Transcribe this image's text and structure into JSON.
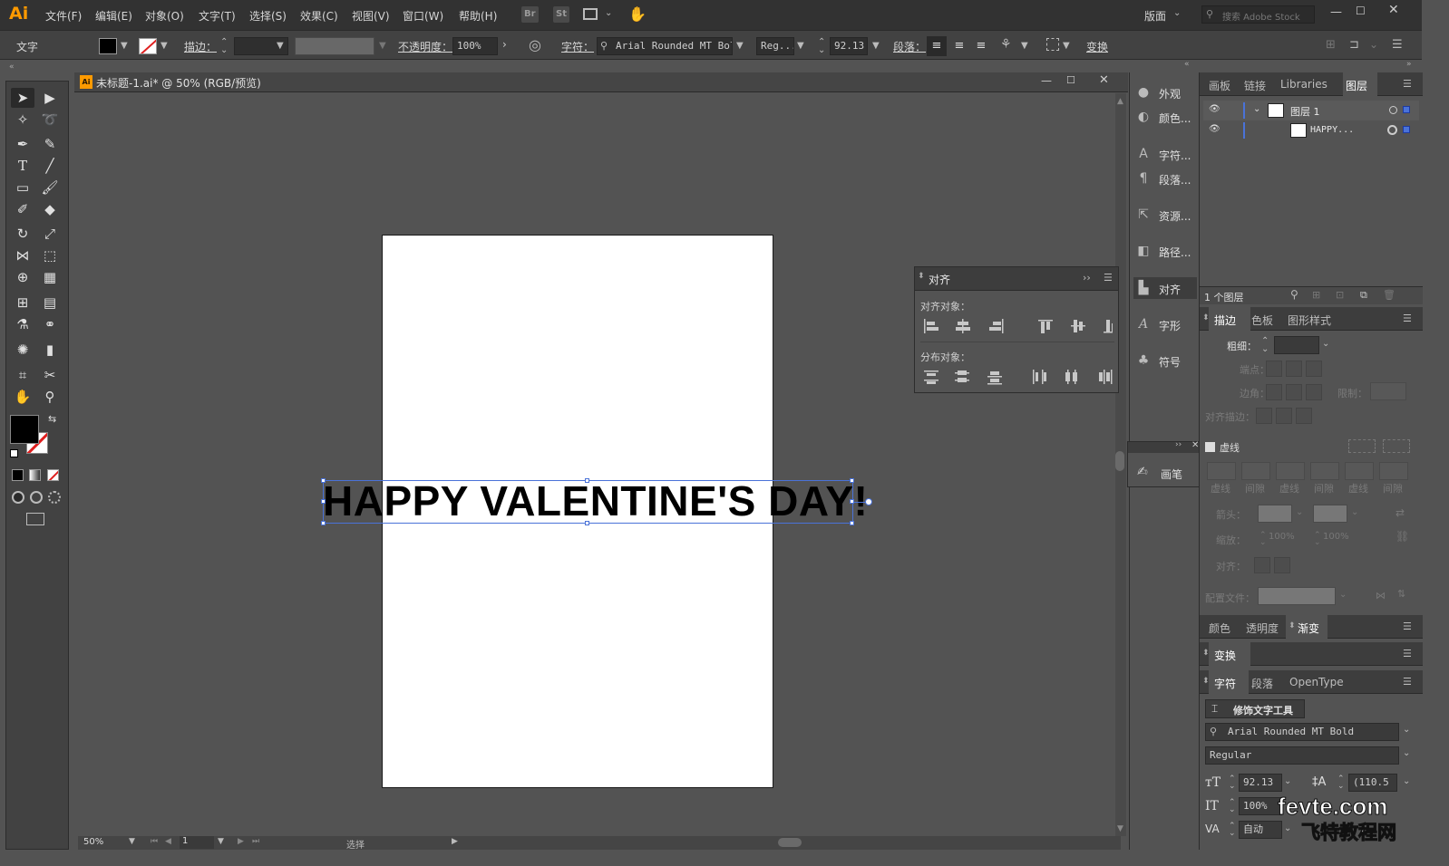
{
  "app": {
    "logo": "Ai"
  },
  "menu": [
    "文件(F)",
    "编辑(E)",
    "对象(O)",
    "文字(T)",
    "选择(S)",
    "效果(C)",
    "视图(V)",
    "窗口(W)",
    "帮助(H)"
  ],
  "app_buttons": {
    "bridge": "Br",
    "stock": "St"
  },
  "workspace": {
    "label": "版面",
    "search_placeholder": "搜索 Adobe Stock"
  },
  "control": {
    "mode": "文字",
    "stroke_label": "描边：",
    "opacity_label": "不透明度：",
    "opacity_value": "100%",
    "char_label": "字符：",
    "font_family": "Arial Rounded MT Bold",
    "font_style": "Reg...",
    "font_size": "92.13 |",
    "paragraph_label": "段落：",
    "transform_label": "变换"
  },
  "document": {
    "title": "未标题-1.ai* @ 50% (RGB/预览)",
    "artboard_text": "HAPPY VALENTINE'S DAY!"
  },
  "status": {
    "zoom": "50%",
    "page": "1",
    "tool": "选择"
  },
  "align_panel": {
    "title": "对齐",
    "align_objects": "对齐对象：",
    "distribute_objects": "分布对象："
  },
  "mid_panels": [
    "外观",
    "颜色...",
    "字符...",
    "段落...",
    "资源...",
    "路径...",
    "对齐",
    "字形",
    "符号"
  ],
  "brush_panel": {
    "label": "画笔"
  },
  "layers_panel": {
    "tabs": [
      "画板",
      "链接",
      "Libraries",
      "图层"
    ],
    "layers": [
      {
        "name": "图层 1"
      },
      {
        "name": "HAPPY..."
      }
    ],
    "footer": "1 个图层"
  },
  "stroke_panel": {
    "tabs": [
      "描边",
      "色板",
      "图形样式"
    ],
    "weight_label": "粗细：",
    "cap_label": "端点：",
    "corner_label": "边角：",
    "limit_label": "限制：",
    "align_stroke_label": "对齐描边：",
    "dashed_label": "虚线",
    "dash_labels": [
      "虚线",
      "间隙",
      "虚线",
      "间隙",
      "虚线",
      "间隙"
    ],
    "arrow_label": "箭头：",
    "scale_label": "缩放：",
    "scale_values": [
      "100%",
      "100%"
    ],
    "align_label": "对齐：",
    "profile_label": "配置文件："
  },
  "color_tabs": [
    "颜色",
    "透明度",
    "渐变"
  ],
  "transform_tab": "变换",
  "char_panel": {
    "tabs": [
      "字符",
      "段落",
      "OpenType"
    ],
    "touch_tool": "修饰文字工具",
    "font_family": "Arial Rounded MT Bold",
    "font_style": "Regular",
    "size": "92.13 |",
    "leading": "(110.5",
    "scale": "100%",
    "tracking": "自动"
  },
  "watermark": {
    "line1": "fevte.com",
    "line2": "飞特教程网"
  },
  "colors": {
    "selection": "#4a72d8",
    "logo": "#ff9a00"
  }
}
